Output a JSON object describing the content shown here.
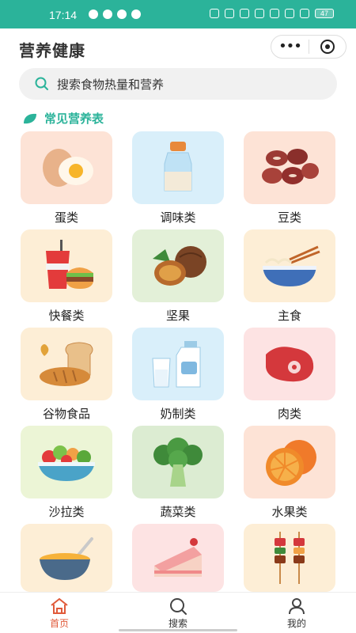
{
  "status_bar": {
    "time": "17:14",
    "battery": "47"
  },
  "app": {
    "title": "营养健康",
    "more_glyph": "•••"
  },
  "search": {
    "placeholder": "搜索食物热量和营养"
  },
  "section": {
    "title": "常见营养表"
  },
  "categories": [
    {
      "label": "蛋类",
      "icon": "egg-icon",
      "bg": "#fde3d6"
    },
    {
      "label": "调味类",
      "icon": "seasoning-bottle-icon",
      "bg": "#d9effa"
    },
    {
      "label": "豆类",
      "icon": "beans-icon",
      "bg": "#fde3d6"
    },
    {
      "label": "快餐类",
      "icon": "fast-food-icon",
      "bg": "#fdeed6"
    },
    {
      "label": "坚果",
      "icon": "nuts-icon",
      "bg": "#e3f0d8"
    },
    {
      "label": "主食",
      "icon": "noodle-bowl-icon",
      "bg": "#fdeed6"
    },
    {
      "label": "谷物食品",
      "icon": "bread-grain-icon",
      "bg": "#fdeed6"
    },
    {
      "label": "奶制类",
      "icon": "milk-icon",
      "bg": "#d9effa"
    },
    {
      "label": "肉类",
      "icon": "meat-icon",
      "bg": "#fde3e3"
    },
    {
      "label": "沙拉类",
      "icon": "salad-icon",
      "bg": "#ecf5d6"
    },
    {
      "label": "蔬菜类",
      "icon": "broccoli-icon",
      "bg": "#dcecd2"
    },
    {
      "label": "水果类",
      "icon": "orange-icon",
      "bg": "#fde3d6"
    },
    {
      "label": "",
      "icon": "soup-bowl-icon",
      "bg": "#fdeed6"
    },
    {
      "label": "",
      "icon": "cake-icon",
      "bg": "#fde3e3"
    },
    {
      "label": "",
      "icon": "skewer-icon",
      "bg": "#fdeed6"
    }
  ],
  "tabs": [
    {
      "label": "首页",
      "icon": "home-icon",
      "active": true
    },
    {
      "label": "搜索",
      "icon": "search-icon",
      "active": false
    },
    {
      "label": "我的",
      "icon": "user-icon",
      "active": false
    }
  ],
  "colors": {
    "brand": "#2bb39a",
    "active_tab": "#e05a3a"
  }
}
